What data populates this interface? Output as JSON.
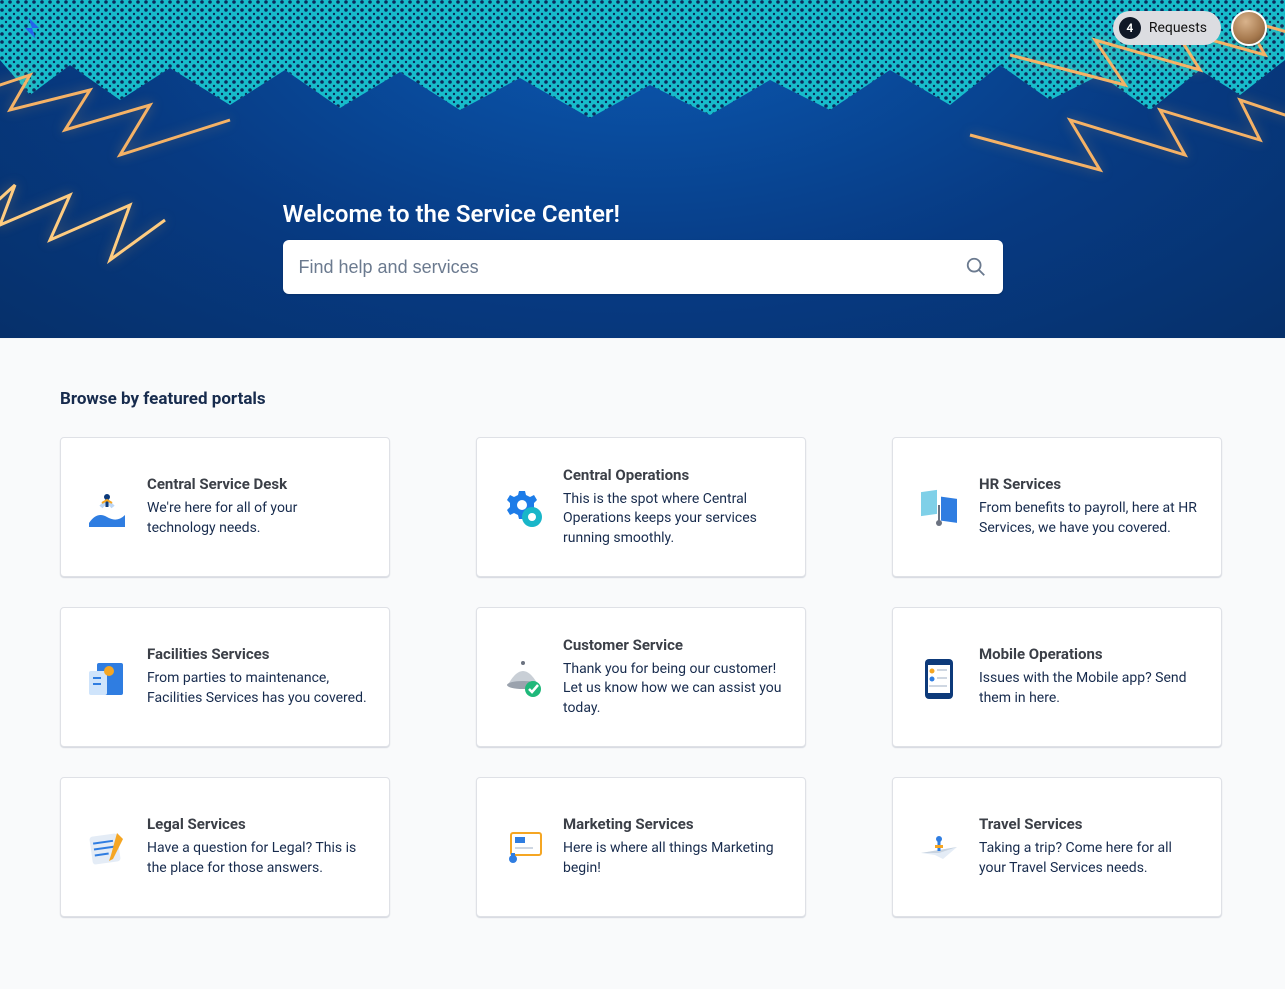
{
  "header": {
    "requests": {
      "count": "4",
      "label": "Requests"
    }
  },
  "hero": {
    "title": "Welcome to the Service Center!",
    "search": {
      "placeholder": "Find help and services"
    }
  },
  "main": {
    "sectionTitle": "Browse by featured portals",
    "portals": [
      {
        "title": "Central Service Desk",
        "desc": "We're here for all of your technology needs."
      },
      {
        "title": "Central Operations",
        "desc": "This is the spot where Central Operations keeps your services running smoothly."
      },
      {
        "title": "HR Services",
        "desc": "From benefits to payroll, here at HR Services, we have you covered."
      },
      {
        "title": "Facilities Services",
        "desc": "From parties to maintenance, Facilities Services has you covered."
      },
      {
        "title": "Customer Service",
        "desc": "Thank you for being our customer! Let us know how we can assist you today."
      },
      {
        "title": "Mobile Operations",
        "desc": "Issues with the Mobile app? Send them in here."
      },
      {
        "title": "Legal Services",
        "desc": "Have a question for Legal? This is the place for those answers."
      },
      {
        "title": "Marketing Services",
        "desc": "Here is where all things Marketing begin!"
      },
      {
        "title": "Travel Services",
        "desc": "Taking a trip? Come here for all your Travel Services needs."
      }
    ]
  }
}
